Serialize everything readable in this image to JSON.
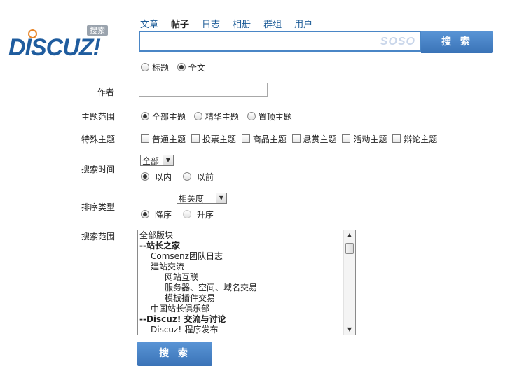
{
  "logo": {
    "text": "DISCUZ!",
    "badge": "搜索"
  },
  "tabs": [
    {
      "label": "文章",
      "active": false
    },
    {
      "label": "帖子",
      "active": true
    },
    {
      "label": "日志",
      "active": false
    },
    {
      "label": "相册",
      "active": false
    },
    {
      "label": "群组",
      "active": false
    },
    {
      "label": "用户",
      "active": false
    }
  ],
  "search": {
    "value": "",
    "watermark": "SOSO",
    "button": "搜 索"
  },
  "scope_options": {
    "title": "标题",
    "fulltext": "全文",
    "selected": "fulltext"
  },
  "author": {
    "label": "作者",
    "value": ""
  },
  "topic_range": {
    "label": "主题范围",
    "options": [
      "全部主题",
      "精华主题",
      "置顶主题"
    ],
    "selected": 0
  },
  "special_topic": {
    "label": "特殊主题",
    "options": [
      "普通主题",
      "投票主题",
      "商品主题",
      "悬赏主题",
      "活动主题",
      "辩论主题"
    ],
    "checked": [
      false,
      false,
      false,
      false,
      false,
      false
    ]
  },
  "search_time": {
    "label": "搜索时间",
    "select_value": "全部",
    "options": [
      "以内",
      "以前"
    ],
    "selected": 0
  },
  "sort_type": {
    "label": "排序类型",
    "select_value": "相关度",
    "options": [
      "降序",
      "升序"
    ],
    "selected": 0
  },
  "search_range": {
    "label": "搜索范围",
    "items": [
      {
        "text": "全部版块",
        "indent": 0,
        "bold": false
      },
      {
        "text": "--站长之家",
        "indent": 0,
        "bold": true
      },
      {
        "text": "Comsenz团队日志",
        "indent": 1,
        "bold": false
      },
      {
        "text": "建站交流",
        "indent": 1,
        "bold": false
      },
      {
        "text": "网站互联",
        "indent": 2,
        "bold": false
      },
      {
        "text": "服务器、空间、域名交易",
        "indent": 2,
        "bold": false
      },
      {
        "text": "模板插件交易",
        "indent": 2,
        "bold": false
      },
      {
        "text": "中国站长俱乐部",
        "indent": 1,
        "bold": false
      },
      {
        "text": "--Discuz! 交流与讨论",
        "indent": 0,
        "bold": true
      },
      {
        "text": "Discuz!-程序发布",
        "indent": 1,
        "bold": false
      }
    ]
  },
  "submit": {
    "label": "搜 索"
  }
}
